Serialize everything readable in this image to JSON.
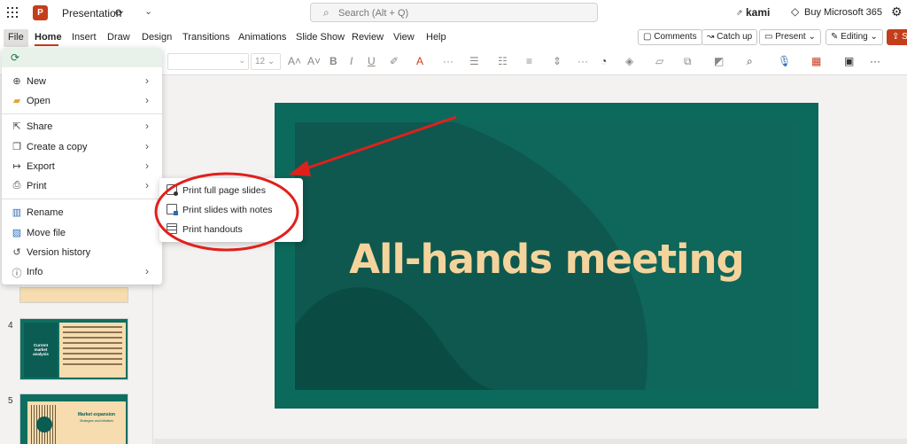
{
  "app": {
    "title": "Presentation",
    "search_placeholder": "Search (Alt + Q)",
    "kami": "kami",
    "buy": "Buy Microsoft 365",
    "logo_letter": "P"
  },
  "tabs": [
    "File",
    "Home",
    "Insert",
    "Draw",
    "Design",
    "Transitions",
    "Animations",
    "Slide Show",
    "Review",
    "View",
    "Help"
  ],
  "right_buttons": {
    "comments": "Comments",
    "catchup": "Catch up",
    "present": "Present",
    "editing": "Editing"
  },
  "ribbon": {
    "font_size": "12"
  },
  "file_menu": {
    "items": [
      {
        "label": "New",
        "icon": "plus-icon",
        "chevron": true
      },
      {
        "label": "Open",
        "icon": "folder-icon",
        "chevron": true
      },
      {
        "label": "Share",
        "icon": "share-icon",
        "chevron": true
      },
      {
        "label": "Create a copy",
        "icon": "copy-icon",
        "chevron": true
      },
      {
        "label": "Export",
        "icon": "export-icon",
        "chevron": true
      },
      {
        "label": "Print",
        "icon": "printer-icon",
        "chevron": true
      },
      {
        "label": "Rename",
        "icon": "rename-icon",
        "chevron": false
      },
      {
        "label": "Move file",
        "icon": "move-file-icon",
        "chevron": false
      },
      {
        "label": "Version history",
        "icon": "history-icon",
        "chevron": false
      },
      {
        "label": "Info",
        "icon": "info-icon",
        "chevron": true
      }
    ]
  },
  "print_submenu": {
    "items": [
      {
        "label": "Print full page slides"
      },
      {
        "label": "Print slides with notes"
      },
      {
        "label": "Print handouts"
      }
    ]
  },
  "slides": {
    "main_title": "All-hands meeting",
    "thumbnails": [
      {
        "number": "4",
        "title": "Current market analysis"
      },
      {
        "number": "5",
        "title": "Market expansion",
        "subtitle": "Strategies and initiatives"
      }
    ]
  },
  "colors": {
    "accent": "#c43e1c",
    "slide_bg": "#0c6a5d",
    "slide_title": "#f4d49c",
    "annotation": "#e0201c"
  }
}
